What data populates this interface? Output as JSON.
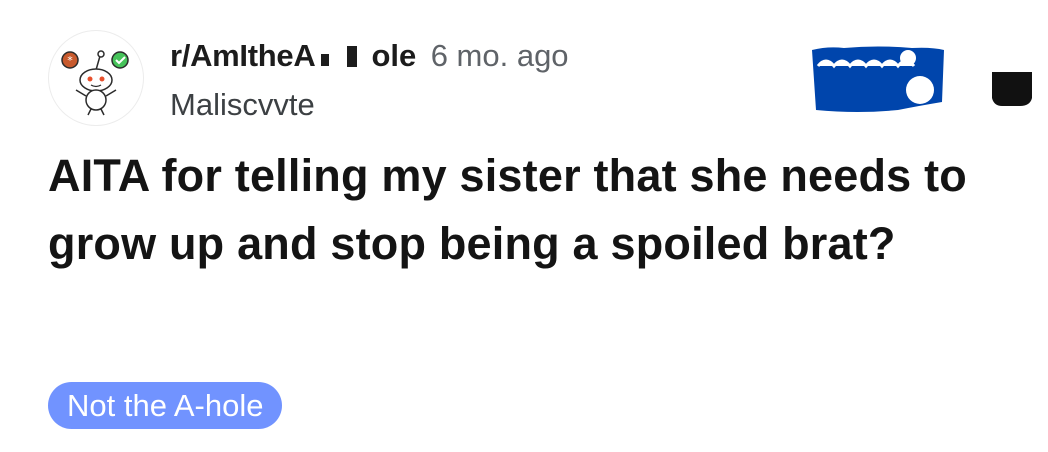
{
  "post_header": {
    "subreddit_start": "r/AmItheA",
    "subreddit_end": "ole",
    "age": "6 mo. ago",
    "author": "Maliscvvte",
    "join_button_color": "#0045ac",
    "more_button_color": "#111111"
  },
  "post": {
    "title": "AITA for telling my sister that she needs to grow up and stop being a spoiled brat?",
    "flair": "Not the A-hole",
    "flair_color": "#7193ff"
  },
  "icons": {
    "avatar": "snoo-avatar-icon",
    "more": "overflow-menu-icon"
  }
}
